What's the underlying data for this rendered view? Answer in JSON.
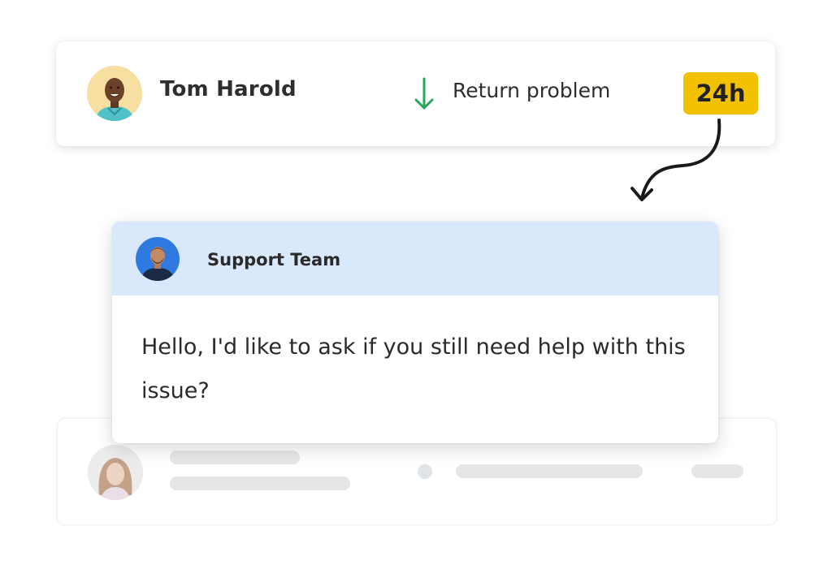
{
  "ticket": {
    "customer_name": "Tom Harold",
    "subject": "Return problem",
    "sla_badge": "24h",
    "arrow_icon": "arrow-down-icon",
    "colors": {
      "arrow": "#2aa65a",
      "badge": "#f2c200"
    }
  },
  "message": {
    "sender": "Support Team",
    "body": "Hello, I'd like to ask if you still need help with this issue?",
    "colors": {
      "header_bg": "#d9e8fb"
    }
  },
  "connector": {
    "icon": "curved-arrow-icon"
  }
}
